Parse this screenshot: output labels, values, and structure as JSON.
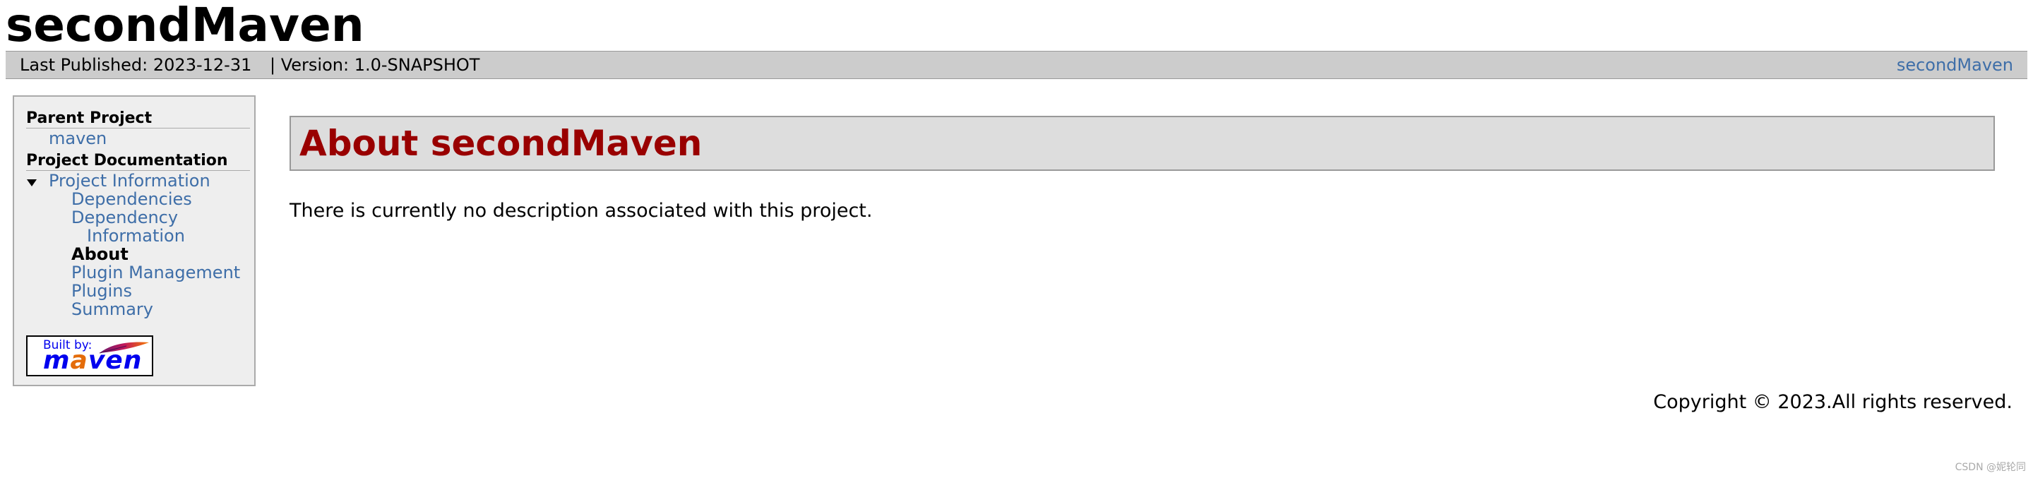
{
  "header": {
    "title": "secondMaven"
  },
  "banner": {
    "last_published": "Last Published: 2023-12-31",
    "separator": "|",
    "version": "Version: 1.0-SNAPSHOT",
    "project_link": "secondMaven"
  },
  "sidebar": {
    "parent_heading": "Parent Project",
    "parent_link": "maven",
    "docs_heading": "Project Documentation",
    "project_info": "Project Information",
    "items": [
      {
        "label": "Dependencies"
      },
      {
        "label": "Dependency"
      },
      {
        "label": "Information"
      },
      {
        "label": "About"
      },
      {
        "label": "Plugin Management"
      },
      {
        "label": "Plugins"
      },
      {
        "label": "Summary"
      }
    ],
    "badge": {
      "built_by": "Built by:",
      "logo_m": "m",
      "logo_a": "a",
      "logo_rest": "ven"
    }
  },
  "content": {
    "heading": "About secondMaven",
    "description": "There is currently no description associated with this project."
  },
  "footer": {
    "copyright": "Copyright © 2023.All rights reserved."
  },
  "watermark": "CSDN @妮轮同",
  "colors": {
    "link": "#3e6ea8",
    "heading": "#990000",
    "banner_bg": "#cccccc",
    "sidebar_bg": "#eeeeee",
    "content_heading_bg": "#dddddd",
    "maven_orange": "#e46c0a"
  }
}
